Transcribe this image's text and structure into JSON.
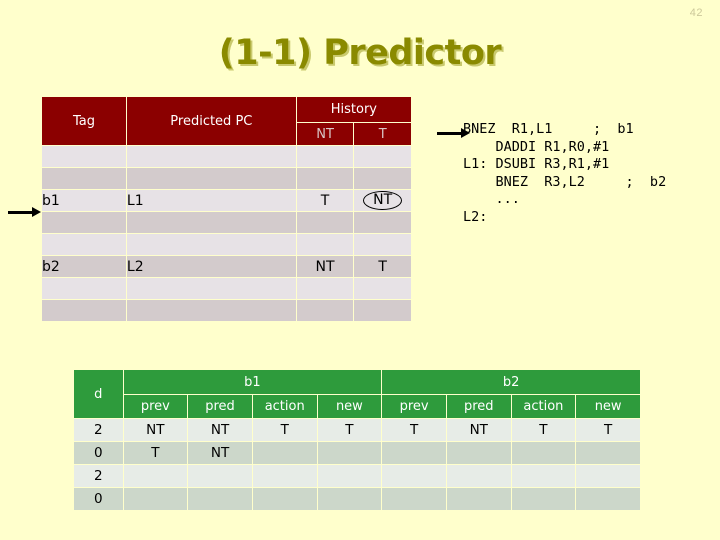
{
  "page_number": "42",
  "title": "(1-1) Predictor",
  "colors": {
    "background": "#ffffcc",
    "title": "#8a8a00",
    "predictor_header": "#8b0000",
    "trace_header": "#2e9b3c",
    "highlight": "#cc0000"
  },
  "predictor_table": {
    "headers": {
      "tag": "Tag",
      "predicted_pc": "Predicted PC",
      "history": "History",
      "history_nt": "NT",
      "history_t": "T"
    },
    "rows": [
      {
        "tag": "",
        "pc": "",
        "nt": "",
        "t": "",
        "circled": false
      },
      {
        "tag": "",
        "pc": "",
        "nt": "",
        "t": "",
        "circled": false
      },
      {
        "tag": "b1",
        "pc": "L1",
        "nt": "T",
        "t": "NT",
        "circled": true
      },
      {
        "tag": "",
        "pc": "",
        "nt": "",
        "t": "",
        "circled": false
      },
      {
        "tag": "",
        "pc": "",
        "nt": "",
        "t": "",
        "circled": false
      },
      {
        "tag": "b2",
        "pc": "L2",
        "nt": "NT",
        "t": "T",
        "circled": false
      },
      {
        "tag": "",
        "pc": "",
        "nt": "",
        "t": "",
        "circled": false
      },
      {
        "tag": "",
        "pc": "",
        "nt": "",
        "t": "",
        "circled": false
      }
    ]
  },
  "code": "BNEZ  R1,L1     ;  b1\n    DADDI R1,R0,#1\nL1: DSUBI R3,R1,#1\n    BNEZ  R3,L2     ;  b2\n    ...\nL2:",
  "trace_table": {
    "d_header": "d",
    "groups": [
      "b1",
      "b2"
    ],
    "sub_headers": [
      "prev",
      "pred",
      "action",
      "new"
    ],
    "rows": [
      {
        "d": "2",
        "b1": {
          "prev": "NT",
          "pred": "NT",
          "action": "T",
          "new": "T",
          "new_highlight": true
        },
        "b2": {
          "prev": "T",
          "pred": "NT",
          "action": "T",
          "new": "T",
          "new_highlight": true
        }
      },
      {
        "d": "0",
        "b1": {
          "prev": "T",
          "pred": "NT",
          "action": "",
          "new": "",
          "new_highlight": false
        },
        "b2": {
          "prev": "",
          "pred": "",
          "action": "",
          "new": "",
          "new_highlight": false
        }
      },
      {
        "d": "2",
        "b1": {
          "prev": "",
          "pred": "",
          "action": "",
          "new": "",
          "new_highlight": false
        },
        "b2": {
          "prev": "",
          "pred": "",
          "action": "",
          "new": "",
          "new_highlight": false
        }
      },
      {
        "d": "0",
        "b1": {
          "prev": "",
          "pred": "",
          "action": "",
          "new": "",
          "new_highlight": false
        },
        "b2": {
          "prev": "",
          "pred": "",
          "action": "",
          "new": "",
          "new_highlight": false
        }
      }
    ]
  }
}
